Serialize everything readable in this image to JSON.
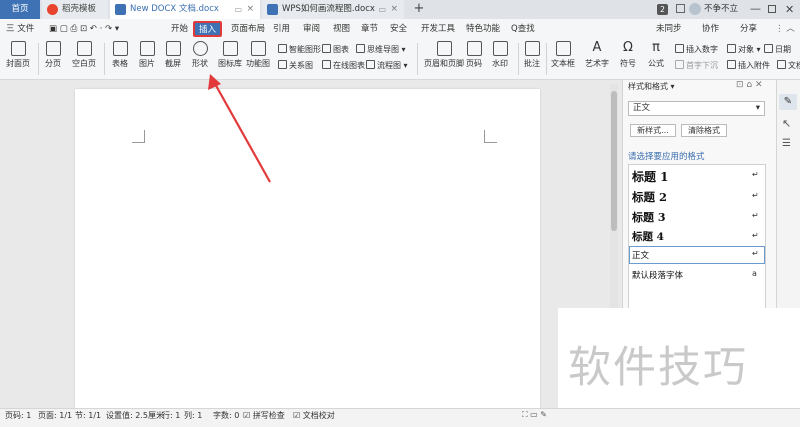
{
  "tabs": {
    "home": "首页",
    "template": "稻壳模板",
    "doc1": "New DOCX 文档.docx",
    "doc2": "WPS如何画流程图.docx"
  },
  "titlebar": {
    "count": "2",
    "user": "不争不立"
  },
  "menu": {
    "file": "三 文件",
    "items": [
      "开始",
      "插入",
      "页面布局",
      "引用",
      "审阅",
      "视图",
      "章节",
      "安全",
      "开发工具",
      "特色功能"
    ],
    "search": "Q查找",
    "sync": "未同步",
    "collab": "协作",
    "share": "分享"
  },
  "ribbon": {
    "cover": "封面页",
    "page_break": "分页",
    "blank_page": "空白页",
    "table": "表格",
    "picture": "图片",
    "screenshot": "截屏",
    "shape": "形状",
    "icon_lib": "图标库",
    "func_chart": "功能图",
    "smart_art": "智能图形",
    "chart": "图表",
    "mind_map": "思维导图",
    "relation": "关系图",
    "online_chart": "在线图表",
    "flowchart": "流程图",
    "header_footer": "页眉和页脚",
    "page_num": "页码",
    "watermark": "水印",
    "comment": "批注",
    "textbox": "文本框",
    "wordart": "艺术字",
    "symbol": "符号",
    "formula": "公式",
    "insert_num": "插入数字",
    "object": "对象",
    "date": "日期",
    "first_sink": "首字下沉",
    "attachment": "插入附件",
    "doc_part": "文档"
  },
  "panel": {
    "title": "样式和格式",
    "current_style": "正文",
    "new_style": "新样式...",
    "clear_format": "清除格式",
    "apply_label": "请选择要应用的格式",
    "styles": [
      "标题 1",
      "标题 2",
      "标题 3",
      "标题 4",
      "正文",
      "默认段落字体"
    ]
  },
  "watermark_text": "软件技巧",
  "status": {
    "page": "页码: 1",
    "pages": "页面: 1/1",
    "section": "节: 1/1",
    "setting": "设置值: 2.5厘米",
    "row": "行: 1",
    "col": "列: 1",
    "words": "字数: 0",
    "spell": "拼写检查",
    "proof": "文档校对"
  },
  "colors": {
    "accent": "#3f72b5",
    "highlight": "#e23a3a",
    "doc_tab_text": "#3a6fb0"
  }
}
